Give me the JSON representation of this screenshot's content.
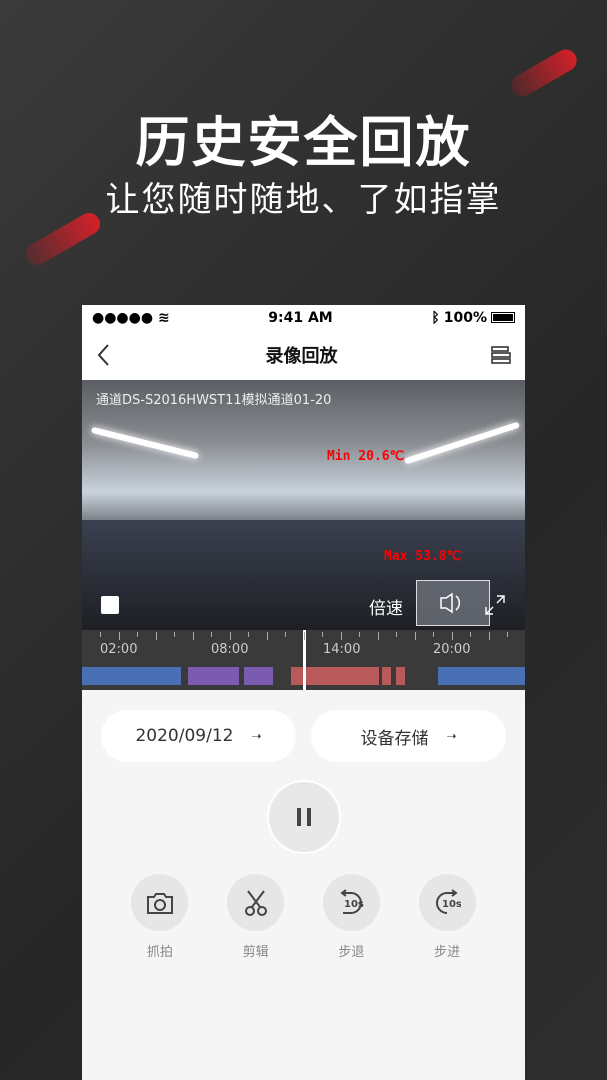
{
  "promo": {
    "headline": "历史安全回放",
    "subheadline": "让您随时随地、了如指掌"
  },
  "status_bar": {
    "time": "9:41 AM",
    "battery": "100%"
  },
  "nav": {
    "title": "录像回放"
  },
  "video": {
    "channel_label": "通道DS-S2016HWST11模拟通道01-20",
    "min_temp": "Min 20.6℃",
    "max_temp": "Max 53.8℃",
    "speed_label": "倍速"
  },
  "timeline": {
    "labels": [
      "02:00",
      "08:00",
      "14:00",
      "20:00"
    ],
    "segment_colors": {
      "blue": "#4a6fb5",
      "purple": "#7a5bb0",
      "red": "#b85a5a"
    }
  },
  "controls": {
    "date": "2020/09/12",
    "storage": "设备存储",
    "tools": [
      {
        "label": "抓拍",
        "icon": "camera-icon"
      },
      {
        "label": "剪辑",
        "icon": "scissors-icon"
      },
      {
        "label": "步退",
        "icon": "rewind-10s-icon"
      },
      {
        "label": "步进",
        "icon": "forward-10s-icon"
      }
    ]
  },
  "colors": {
    "accent": "#d6202a"
  }
}
